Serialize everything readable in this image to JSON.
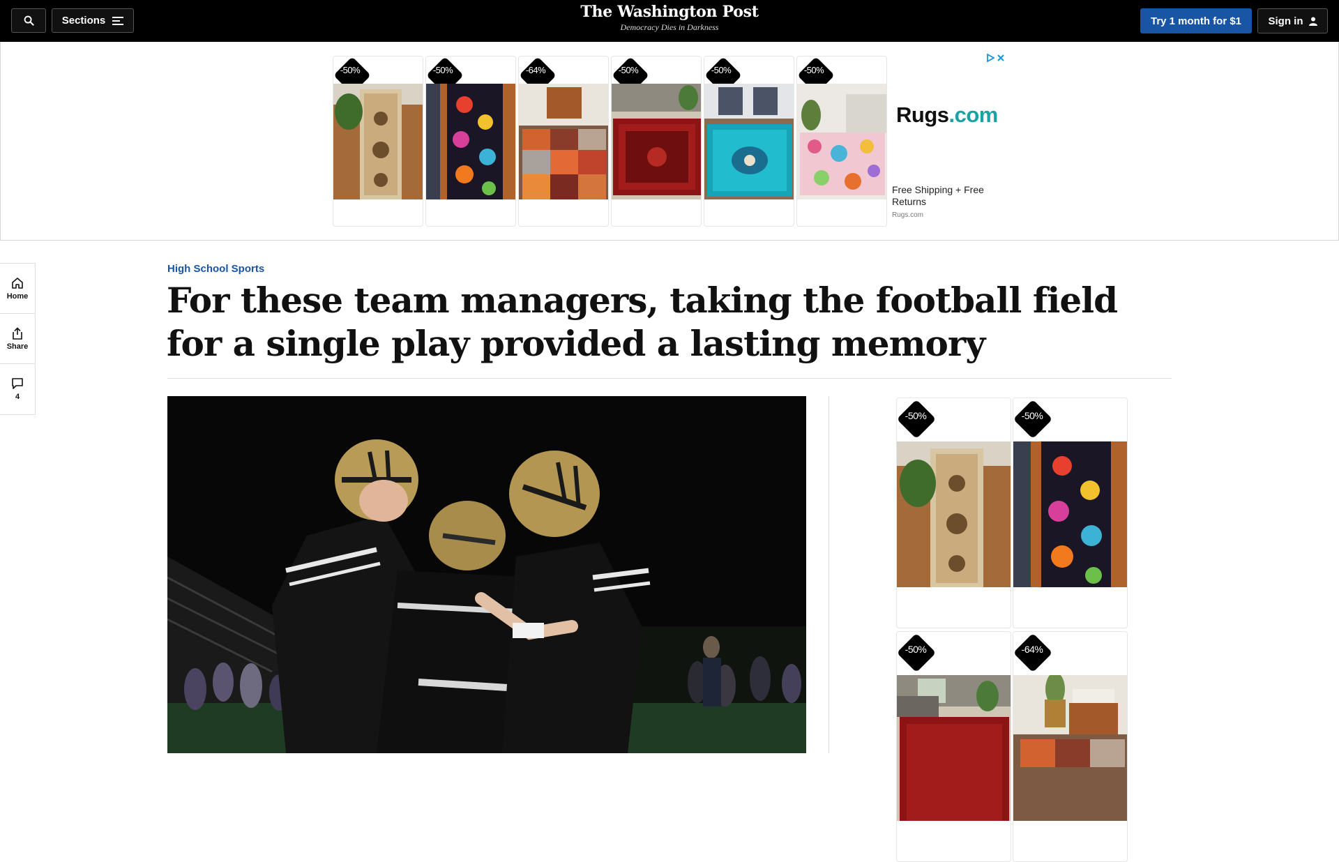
{
  "nav": {
    "sections_label": "Sections",
    "masthead_title": "The Washington Post",
    "masthead_tagline": "Democracy Dies in Darkness",
    "trial_label": "Try 1 month for $1",
    "signin_label": "Sign in"
  },
  "top_ad": {
    "products": [
      {
        "discount": "-50%"
      },
      {
        "discount": "-50%"
      },
      {
        "discount": "-64%"
      },
      {
        "discount": "-50%"
      },
      {
        "discount": "-50%"
      },
      {
        "discount": "-50%"
      }
    ],
    "brand": "Rugs",
    "brand_suffix": ".com",
    "tagline": "Free Shipping + Free Returns",
    "domain": "Rugs.com"
  },
  "rail": {
    "home_label": "Home",
    "share_label": "Share",
    "comments_count": "4"
  },
  "article": {
    "kicker": "High School Sports",
    "headline": "For these team managers, taking the football field for a single play provided a lasting memory"
  },
  "side_ad": {
    "products": [
      {
        "discount": "-50%"
      },
      {
        "discount": "-50%"
      },
      {
        "discount": "-50%"
      },
      {
        "discount": "-64%"
      }
    ]
  },
  "colors": {
    "accent_blue": "#1955a5",
    "nav_bg": "#000000",
    "adchoice_blue": "#1a96d4"
  }
}
